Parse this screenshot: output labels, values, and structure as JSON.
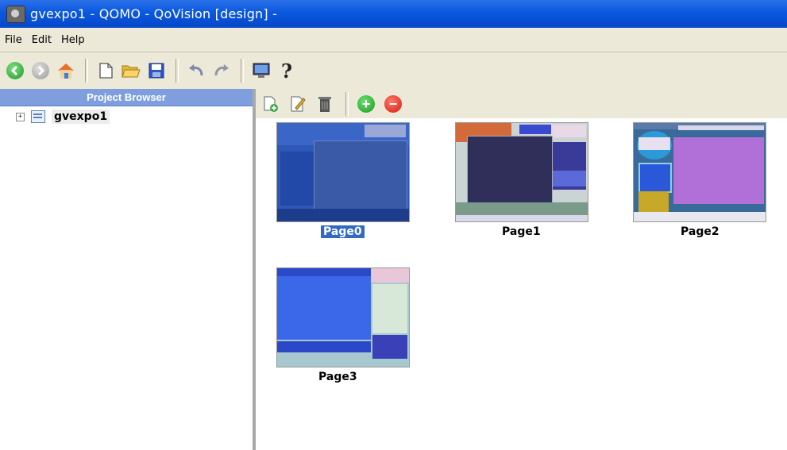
{
  "window": {
    "title": "gvexpo1 - QOMO - QoVision [design] -"
  },
  "menu": {
    "items": [
      "File",
      "Edit",
      "Help"
    ]
  },
  "toolbar": {
    "buttons": [
      "back-icon",
      "forward-icon",
      "home-icon",
      "new-page-icon",
      "open-folder-icon",
      "save-icon",
      "undo-icon",
      "redo-icon",
      "monitor-icon",
      "help-icon"
    ],
    "help_glyph": "?"
  },
  "project_browser": {
    "title": "Project Browser",
    "tree": [
      {
        "label": "gvexpo1",
        "expander": "+"
      }
    ]
  },
  "page_toolbar": {
    "buttons": [
      "add-page-icon",
      "edit-page-icon",
      "delete-page-icon",
      "add-green-icon",
      "remove-red-icon"
    ],
    "add_glyph": "+",
    "remove_glyph": "−"
  },
  "pages": [
    {
      "label": "Page0",
      "selected": true
    },
    {
      "label": "Page1",
      "selected": false
    },
    {
      "label": "Page2",
      "selected": false
    },
    {
      "label": "Page3",
      "selected": false
    }
  ],
  "colors": {
    "titlebar": "#0a58e0",
    "chrome": "#ece9d8",
    "panel_header": "#7f9ede",
    "selection": "#316ac5"
  }
}
